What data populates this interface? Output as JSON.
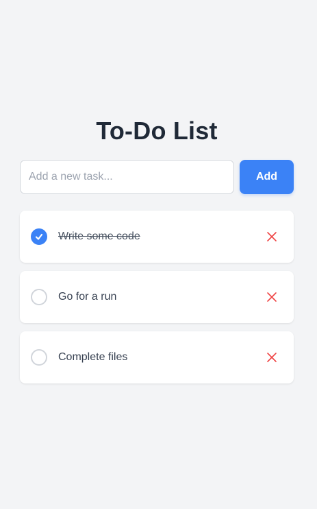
{
  "app": {
    "title": "To-Do List"
  },
  "form": {
    "input_value": "",
    "input_placeholder": "Add a new task...",
    "add_label": "Add"
  },
  "tasks": [
    {
      "text": "Write some code",
      "completed": true
    },
    {
      "text": "Go for a run",
      "completed": false
    },
    {
      "text": "Complete files",
      "completed": false
    }
  ],
  "icons": {
    "check": "check-icon",
    "delete": "close-icon"
  },
  "colors": {
    "accent": "#3b82f6",
    "delete": "#ef4444",
    "background": "#f3f4f6",
    "title": "#1f2937"
  }
}
